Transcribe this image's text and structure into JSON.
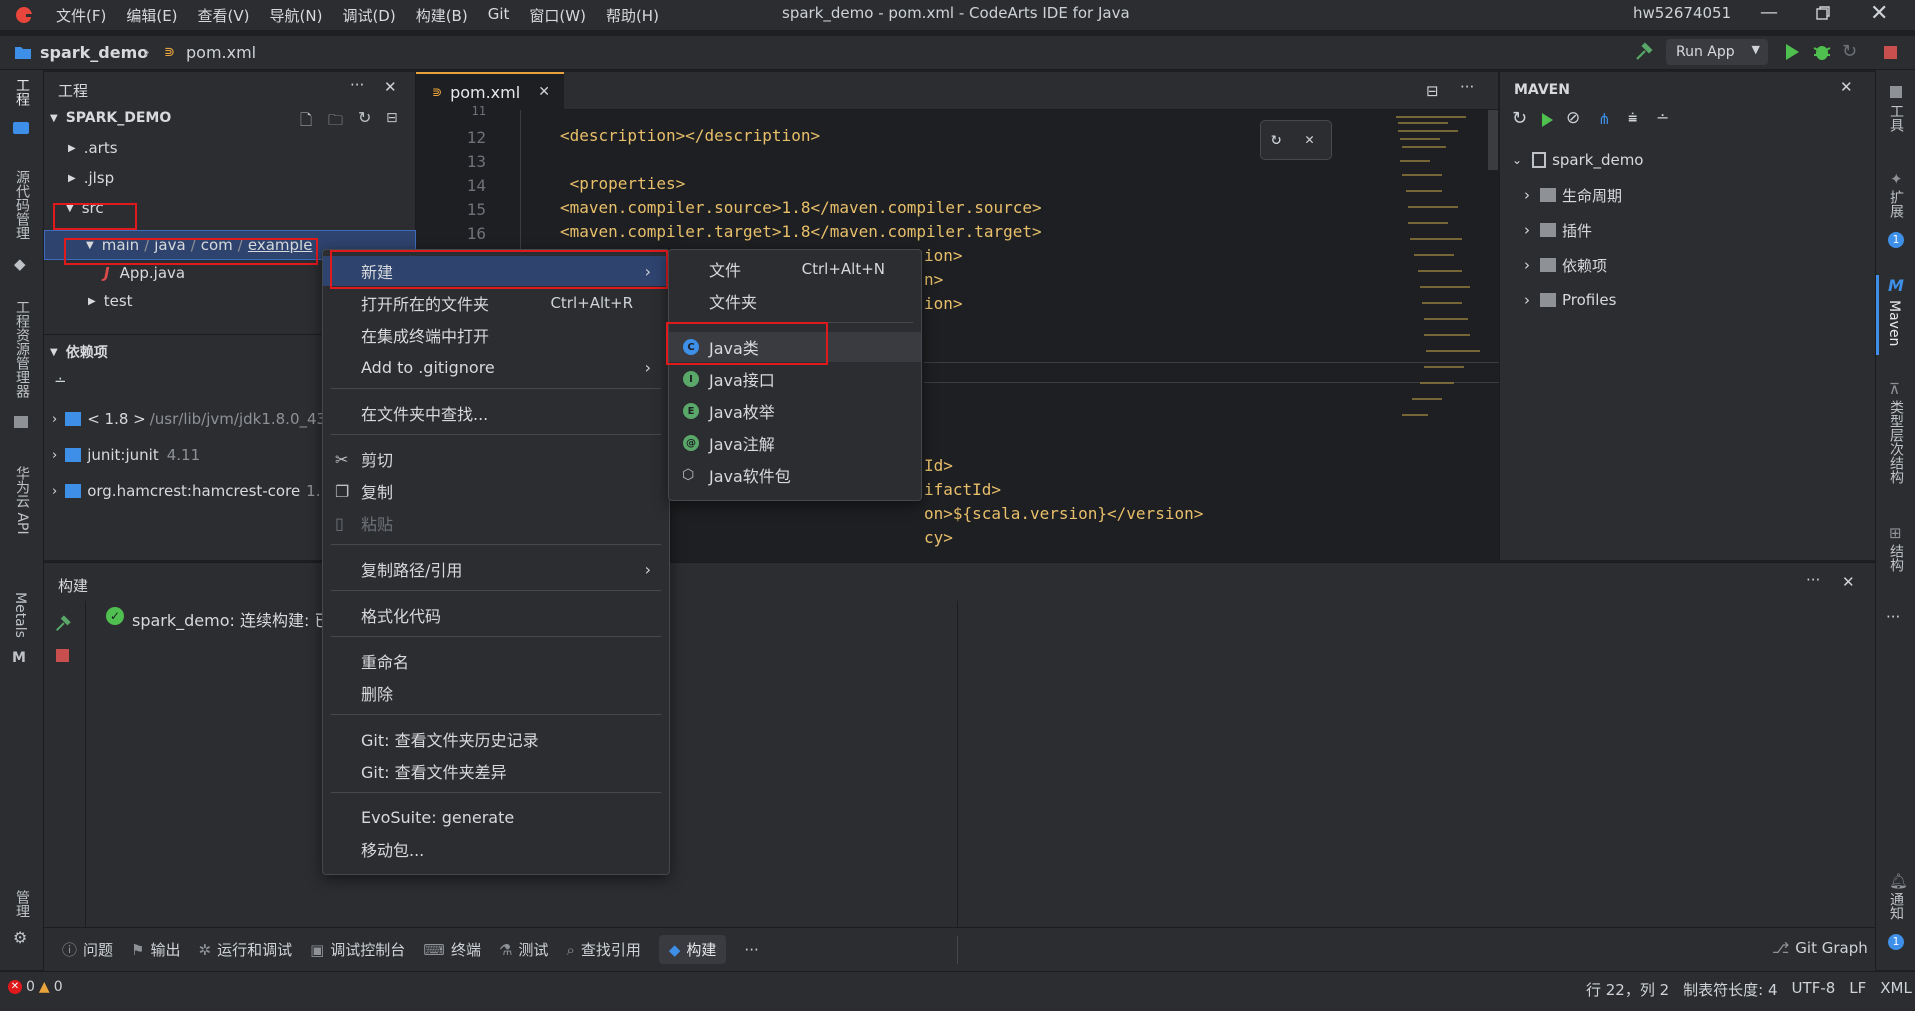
{
  "window": {
    "title": "spark_demo - pom.xml - CodeArts IDE for Java",
    "user": "hw52674051",
    "menus": [
      "文件(F)",
      "编辑(E)",
      "查看(V)",
      "导航(N)",
      "调试(D)",
      "构建(B)",
      "Git",
      "窗口(W)",
      "帮助(H)"
    ]
  },
  "breadcrumb": {
    "project": "spark_demo",
    "file": "pom.xml"
  },
  "toolbar": {
    "run_config": "Run App"
  },
  "left_activity": [
    "工程",
    "源代码管理",
    "工程资源管理器",
    "华为云 API",
    "Metals",
    "管理"
  ],
  "right_activity": [
    "工具",
    "扩展",
    "Maven",
    "类型层次结构",
    "结构",
    "通知"
  ],
  "project_panel": {
    "title": "工程",
    "root": "SPARK_DEMO",
    "items": [
      ".arts",
      ".jlsp",
      "src"
    ],
    "path": [
      "main",
      "java",
      "com",
      "example"
    ],
    "file": "App.java",
    "test": "test",
    "deps_title": "依赖项",
    "deps": [
      {
        "name": "< 1.8 >",
        "detail": "/usr/lib/jvm/jdk1.8.0_43"
      },
      {
        "name": "junit:junit",
        "detail": "4.11"
      },
      {
        "name": "org.hamcrest:hamcrest-core",
        "detail": "1."
      }
    ]
  },
  "editor": {
    "tab": "pom.xml",
    "lines": [
      {
        "n": "11",
        "code": ""
      },
      {
        "n": "12",
        "code": "<description></description>"
      },
      {
        "n": "13",
        "code": ""
      },
      {
        "n": "14",
        "code": " <properties>"
      },
      {
        "n": "15",
        "code": "<maven.compiler.source>1.8</maven.compiler.source>"
      },
      {
        "n": "16",
        "code": "<maven.compiler.target>1.8</maven.compiler.target>"
      }
    ],
    "fragments": [
      "ion>",
      "n>",
      "ion>",
      "Id>",
      "ifactId>",
      "on>${scala.version}</version>",
      "cy>"
    ]
  },
  "maven": {
    "title": "MAVEN",
    "root": "spark_demo",
    "items": [
      "生命周期",
      "插件",
      "依赖项",
      "Profiles"
    ]
  },
  "build": {
    "title": "构建",
    "status": "spark_demo: 连续构建: 已"
  },
  "context_menu": {
    "items": [
      {
        "label": "新建",
        "submenu": true
      },
      {
        "label": "打开所在的文件夹",
        "shortcut": "Ctrl+Alt+R"
      },
      {
        "label": "在集成终端中打开"
      },
      {
        "label": "Add to .gitignore",
        "submenu": true
      },
      {
        "label": "在文件夹中查找..."
      },
      {
        "label": "剪切"
      },
      {
        "label": "复制"
      },
      {
        "label": "粘贴"
      },
      {
        "label": "复制路径/引用",
        "submenu": true
      },
      {
        "label": "格式化代码"
      },
      {
        "label": "重命名"
      },
      {
        "label": "删除"
      },
      {
        "label": "Git: 查看文件夹历史记录"
      },
      {
        "label": "Git: 查看文件夹差异"
      },
      {
        "label": "EvoSuite: generate"
      },
      {
        "label": "移动包..."
      }
    ]
  },
  "submenu": {
    "items": [
      {
        "label": "文件",
        "shortcut": "Ctrl+Alt+N"
      },
      {
        "label": "文件夹"
      },
      {
        "label": "Java类",
        "badge": "C",
        "color": "#3d8fe8"
      },
      {
        "label": "Java接口",
        "badge": "I",
        "color": "#59a869"
      },
      {
        "label": "Java枚举",
        "badge": "E",
        "color": "#59a869"
      },
      {
        "label": "Java注解",
        "badge": "@",
        "color": "#59a869"
      },
      {
        "label": "Java软件包"
      }
    ]
  },
  "bottom_tabs": [
    "问题",
    "输出",
    "运行和调试",
    "调试控制台",
    "终端",
    "测试",
    "查找引用",
    "构建"
  ],
  "git_graph": "Git Graph",
  "status": {
    "errors": "0",
    "warnings": "0",
    "position": "行 22，列 2",
    "tab": "制表符长度: 4",
    "encoding": "UTF-8",
    "eol": "LF",
    "lang": "XML"
  },
  "colors": {
    "accent_red": "#e0191d",
    "selection": "#2e436e",
    "xml_tag": "#e8bf6a"
  }
}
